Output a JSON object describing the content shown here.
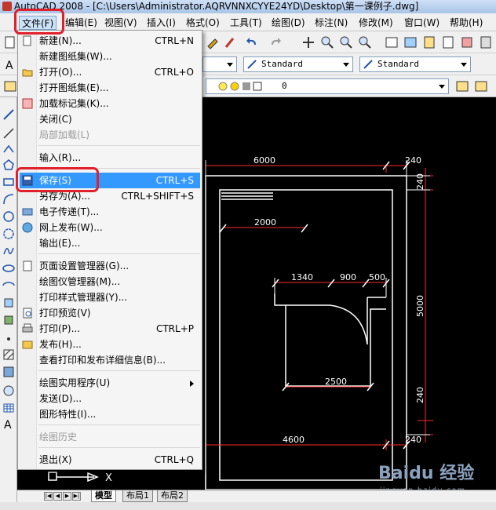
{
  "window": {
    "title": "AutoCAD 2008 - [C:\\Users\\Administrator.AQRVNNXCYYE24YD\\Desktop\\第一课例子.dwg]"
  },
  "menubar": {
    "items": [
      "文件(F)",
      "编辑(E)",
      "视图(V)",
      "插入(I)",
      "格式(O)",
      "工具(T)",
      "绘图(D)",
      "标注(N)",
      "修改(M)",
      "窗口(W)",
      "帮助(H)"
    ]
  },
  "toolbar": {
    "text_style": "Standard",
    "dim_style": "Standard",
    "layer": "0"
  },
  "file_menu": {
    "items": [
      {
        "label": "新建(N)...",
        "shortcut": "CTRL+N"
      },
      {
        "label": "新建图纸集(W)...",
        "shortcut": ""
      },
      {
        "label": "打开(O)...",
        "shortcut": "CTRL+O"
      },
      {
        "label": "打开图纸集(E)...",
        "shortcut": ""
      },
      {
        "label": "加载标记集(K)...",
        "shortcut": ""
      },
      {
        "label": "关闭(C)",
        "shortcut": ""
      },
      {
        "label": "局部加载(L)",
        "shortcut": ""
      },
      {
        "label": "输入(R)...",
        "shortcut": ""
      },
      {
        "label": "保存(S)",
        "shortcut": "CTRL+S"
      },
      {
        "label": "另存为(A)...",
        "shortcut": "CTRL+SHIFT+S"
      },
      {
        "label": "电子传递(T)...",
        "shortcut": ""
      },
      {
        "label": "网上发布(W)...",
        "shortcut": ""
      },
      {
        "label": "输出(E)...",
        "shortcut": ""
      },
      {
        "label": "页面设置管理器(G)...",
        "shortcut": ""
      },
      {
        "label": "绘图仪管理器(M)...",
        "shortcut": ""
      },
      {
        "label": "打印样式管理器(Y)...",
        "shortcut": ""
      },
      {
        "label": "打印预览(V)",
        "shortcut": ""
      },
      {
        "label": "打印(P)...",
        "shortcut": "CTRL+P"
      },
      {
        "label": "发布(H)...",
        "shortcut": ""
      },
      {
        "label": "查看打印和发布详细信息(B)...",
        "shortcut": ""
      },
      {
        "label": "绘图实用程序(U)",
        "shortcut": ""
      },
      {
        "label": "发送(D)...",
        "shortcut": ""
      },
      {
        "label": "图形特性(I)...",
        "shortcut": ""
      },
      {
        "label": "绘图历史",
        "shortcut": ""
      },
      {
        "label": "退出(X)",
        "shortcut": "CTRL+Q"
      }
    ]
  },
  "drawing": {
    "dims": {
      "top_width": "6000",
      "top_wall_right": "240",
      "inner_width": "2000",
      "seg_1": "1340",
      "seg_2": "900",
      "seg_3": "500",
      "bottom_inner": "2500",
      "bottom_width": "4600",
      "bottom_wall_right": "240",
      "right_top": "240",
      "right_height": "5000",
      "right_bottom": "240"
    },
    "ucs_x": "X"
  },
  "tabs": [
    "模型",
    "布局1",
    "布局2"
  ],
  "watermark": {
    "brand": "Baidu 经验",
    "url": "jingyan.baidu.com"
  },
  "colors": {
    "highlight": "#3399ff",
    "annotation_ring": "#e0202a",
    "dimension": "#ff2a2a",
    "canvas": "#000000"
  }
}
